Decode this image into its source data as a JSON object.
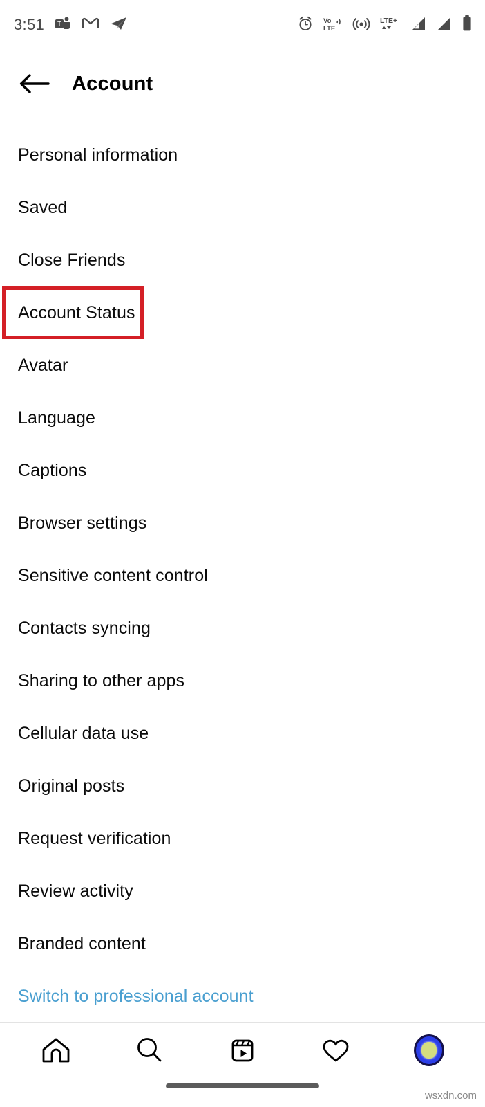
{
  "status_bar": {
    "time": "3:51",
    "left_icons": [
      {
        "name": "microsoft-teams-icon",
        "label": "Teams"
      },
      {
        "name": "gmail-icon",
        "label": "Gmail"
      },
      {
        "name": "telegram-icon",
        "label": "Telegram"
      }
    ],
    "right_icons": [
      {
        "name": "alarm-clock-icon",
        "label": "Alarm"
      },
      {
        "name": "volte-icon",
        "label": "VoLTE"
      },
      {
        "name": "hotspot-icon",
        "label": "Hotspot"
      },
      {
        "name": "lte-plus-icon",
        "label": "LTE+"
      },
      {
        "name": "signal-bars-sim1-icon",
        "label": "Signal 1"
      },
      {
        "name": "signal-bars-sim2-icon",
        "label": "Signal 2"
      },
      {
        "name": "battery-icon",
        "label": "Battery"
      }
    ]
  },
  "header": {
    "back_label": "Back",
    "title": "Account"
  },
  "settings": {
    "items": [
      {
        "label": "Personal information",
        "highlighted": false,
        "link": false
      },
      {
        "label": "Saved",
        "highlighted": false,
        "link": false
      },
      {
        "label": "Close Friends",
        "highlighted": false,
        "link": false
      },
      {
        "label": "Account Status",
        "highlighted": true,
        "link": false
      },
      {
        "label": "Avatar",
        "highlighted": false,
        "link": false
      },
      {
        "label": "Language",
        "highlighted": false,
        "link": false
      },
      {
        "label": "Captions",
        "highlighted": false,
        "link": false
      },
      {
        "label": "Browser settings",
        "highlighted": false,
        "link": false
      },
      {
        "label": "Sensitive content control",
        "highlighted": false,
        "link": false
      },
      {
        "label": "Contacts syncing",
        "highlighted": false,
        "link": false
      },
      {
        "label": "Sharing to other apps",
        "highlighted": false,
        "link": false
      },
      {
        "label": "Cellular data use",
        "highlighted": false,
        "link": false
      },
      {
        "label": "Original posts",
        "highlighted": false,
        "link": false
      },
      {
        "label": "Request verification",
        "highlighted": false,
        "link": false
      },
      {
        "label": "Review activity",
        "highlighted": false,
        "link": false
      },
      {
        "label": "Branded content",
        "highlighted": false,
        "link": false
      },
      {
        "label": "Switch to professional account",
        "highlighted": false,
        "link": true
      }
    ]
  },
  "bottom_nav": {
    "items": [
      {
        "name": "nav-home",
        "label": "Home"
      },
      {
        "name": "nav-search",
        "label": "Search"
      },
      {
        "name": "nav-reels",
        "label": "Reels"
      },
      {
        "name": "nav-activity",
        "label": "Activity"
      },
      {
        "name": "nav-profile",
        "label": "Profile"
      }
    ]
  },
  "watermark": "wsxdn.com",
  "colors": {
    "highlight_border": "#d41f26",
    "link_text": "#4a9fd0",
    "text": "#0b0b0b",
    "status_icon": "#4a4a4a",
    "avatar_ring": "#2b3ee8"
  }
}
